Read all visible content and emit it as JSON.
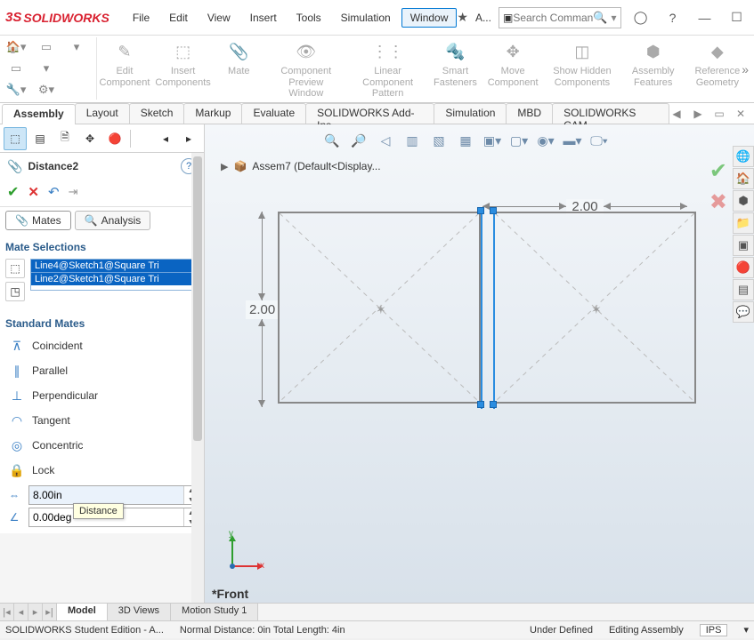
{
  "app": {
    "brand_prefix": "3S",
    "brand": "SOLIDWORKS"
  },
  "menu": [
    "File",
    "Edit",
    "View",
    "Insert",
    "Tools",
    "Simulation",
    "Window"
  ],
  "menu_active_index": 6,
  "title_extra": "A...",
  "search": {
    "placeholder": "Search Comman"
  },
  "ribbon_groups": [
    {
      "label": "Edit Component"
    },
    {
      "label": "Insert Components"
    },
    {
      "label": "Mate"
    },
    {
      "label": "Component Preview Window"
    },
    {
      "label": "Linear Component Pattern"
    },
    {
      "label": "Smart Fasteners"
    },
    {
      "label": "Move Component"
    },
    {
      "label": "Show Hidden Components"
    },
    {
      "label": "Assembly Features"
    },
    {
      "label": "Reference Geometry"
    }
  ],
  "ribbon_tabs": [
    "Assembly",
    "Layout",
    "Sketch",
    "Markup",
    "Evaluate",
    "SOLIDWORKS Add-Ins",
    "Simulation",
    "MBD",
    "SOLIDWORKS CAM"
  ],
  "ribbon_tab_active": 0,
  "feature": {
    "title": "Distance2",
    "tabs": {
      "mates": "Mates",
      "analysis": "Analysis"
    },
    "sections": {
      "selections": "Mate Selections",
      "standard": "Standard Mates"
    },
    "selections": [
      "Line4@Sketch1@Square Tri",
      "Line2@Sketch1@Square Tri"
    ],
    "mates": [
      "Coincident",
      "Parallel",
      "Perpendicular",
      "Tangent",
      "Concentric",
      "Lock"
    ],
    "distance_value": "8.00in",
    "angle_value": "0.00deg",
    "tooltip": "Distance"
  },
  "graphics": {
    "doc": "Assem7  (Default<Display...",
    "dim_h": "2.00",
    "dim_v": "2.00",
    "view": "*Front",
    "y": "y",
    "x": "x"
  },
  "bottom_tabs": [
    "Model",
    "3D Views",
    "Motion Study 1"
  ],
  "status": {
    "left": "SOLIDWORKS Student Edition - A...",
    "mid": "Normal Distance: 0in Total Length: 4in",
    "state": "Under Defined",
    "mode": "Editing Assembly",
    "units": "IPS"
  }
}
